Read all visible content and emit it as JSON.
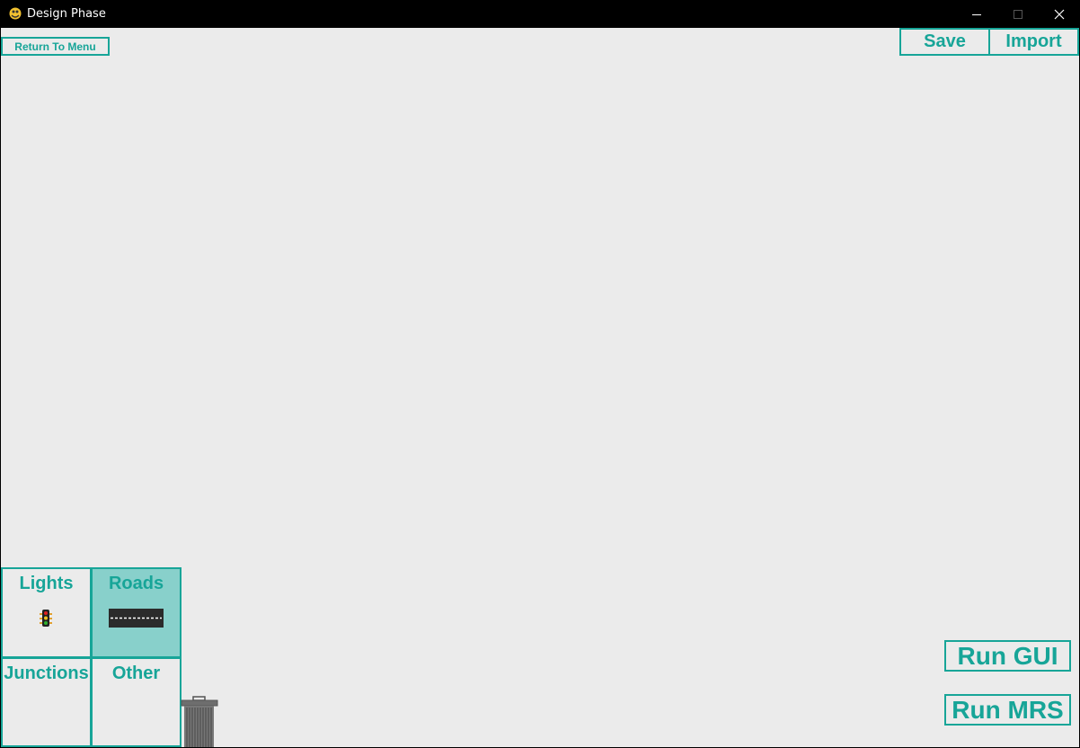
{
  "window": {
    "title": "Design Phase",
    "controls": [
      "minimize-icon",
      "maximize-icon",
      "close-icon"
    ]
  },
  "toolbar": {
    "return_label": "Return To Menu",
    "save_label": "Save",
    "import_label": "Import"
  },
  "palette": {
    "selected": "Roads",
    "tiles": [
      {
        "label": "Lights",
        "icon": "traffic-light-icon"
      },
      {
        "label": "Roads",
        "icon": "road-icon"
      },
      {
        "label": "Junctions",
        "icon": ""
      },
      {
        "label": "Other",
        "icon": ""
      }
    ]
  },
  "trash": {
    "icon": "trash-can-icon"
  },
  "run": {
    "gui_label": "Run GUI",
    "mrs_label": "Run MRS"
  },
  "colors": {
    "accent": "#17a598",
    "selected_tile": "#88d0cb",
    "canvas": "#ebebeb",
    "titlebar": "#000000"
  }
}
